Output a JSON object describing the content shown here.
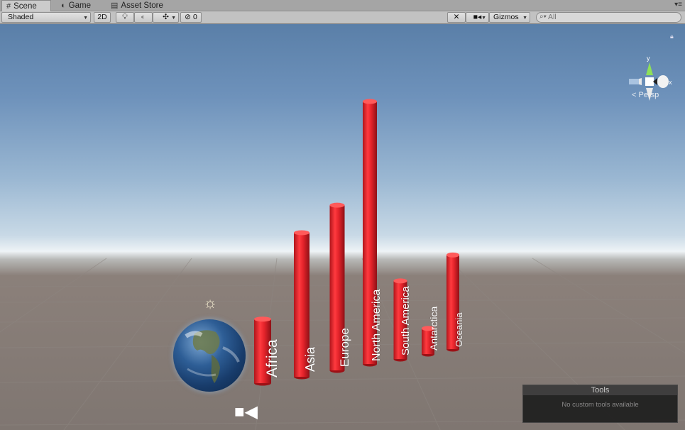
{
  "tabs": [
    {
      "label": "Scene",
      "icon": "grid-icon",
      "active": true
    },
    {
      "label": "Game",
      "icon": "pacman-icon",
      "active": false
    },
    {
      "label": "Asset Store",
      "icon": "store-icon",
      "active": false
    }
  ],
  "toolbar": {
    "shading_mode": "Shaded",
    "mode_2d": "2D",
    "hidden_count": "0",
    "gizmos_label": "Gizmos",
    "search_placeholder": "All"
  },
  "scene": {
    "persp_label": "Persp",
    "gizmo_axis_y": "y",
    "gizmo_axis_x": "x"
  },
  "bars": [
    {
      "label": "Africa",
      "value": 100
    },
    {
      "label": "Asia",
      "value": 225
    },
    {
      "label": "Europe",
      "value": 258
    },
    {
      "label": "North America",
      "value": 410
    },
    {
      "label": "South America",
      "value": 122
    },
    {
      "label": "Antarctica",
      "value": 40
    },
    {
      "label": "Oceania",
      "value": 147
    }
  ],
  "tools_panel": {
    "title": "Tools",
    "message": "No custom tools available"
  },
  "colors": {
    "bar_red": "#e0242b",
    "bar_dark": "#9c1116",
    "bar_light": "#ff5a5a"
  }
}
